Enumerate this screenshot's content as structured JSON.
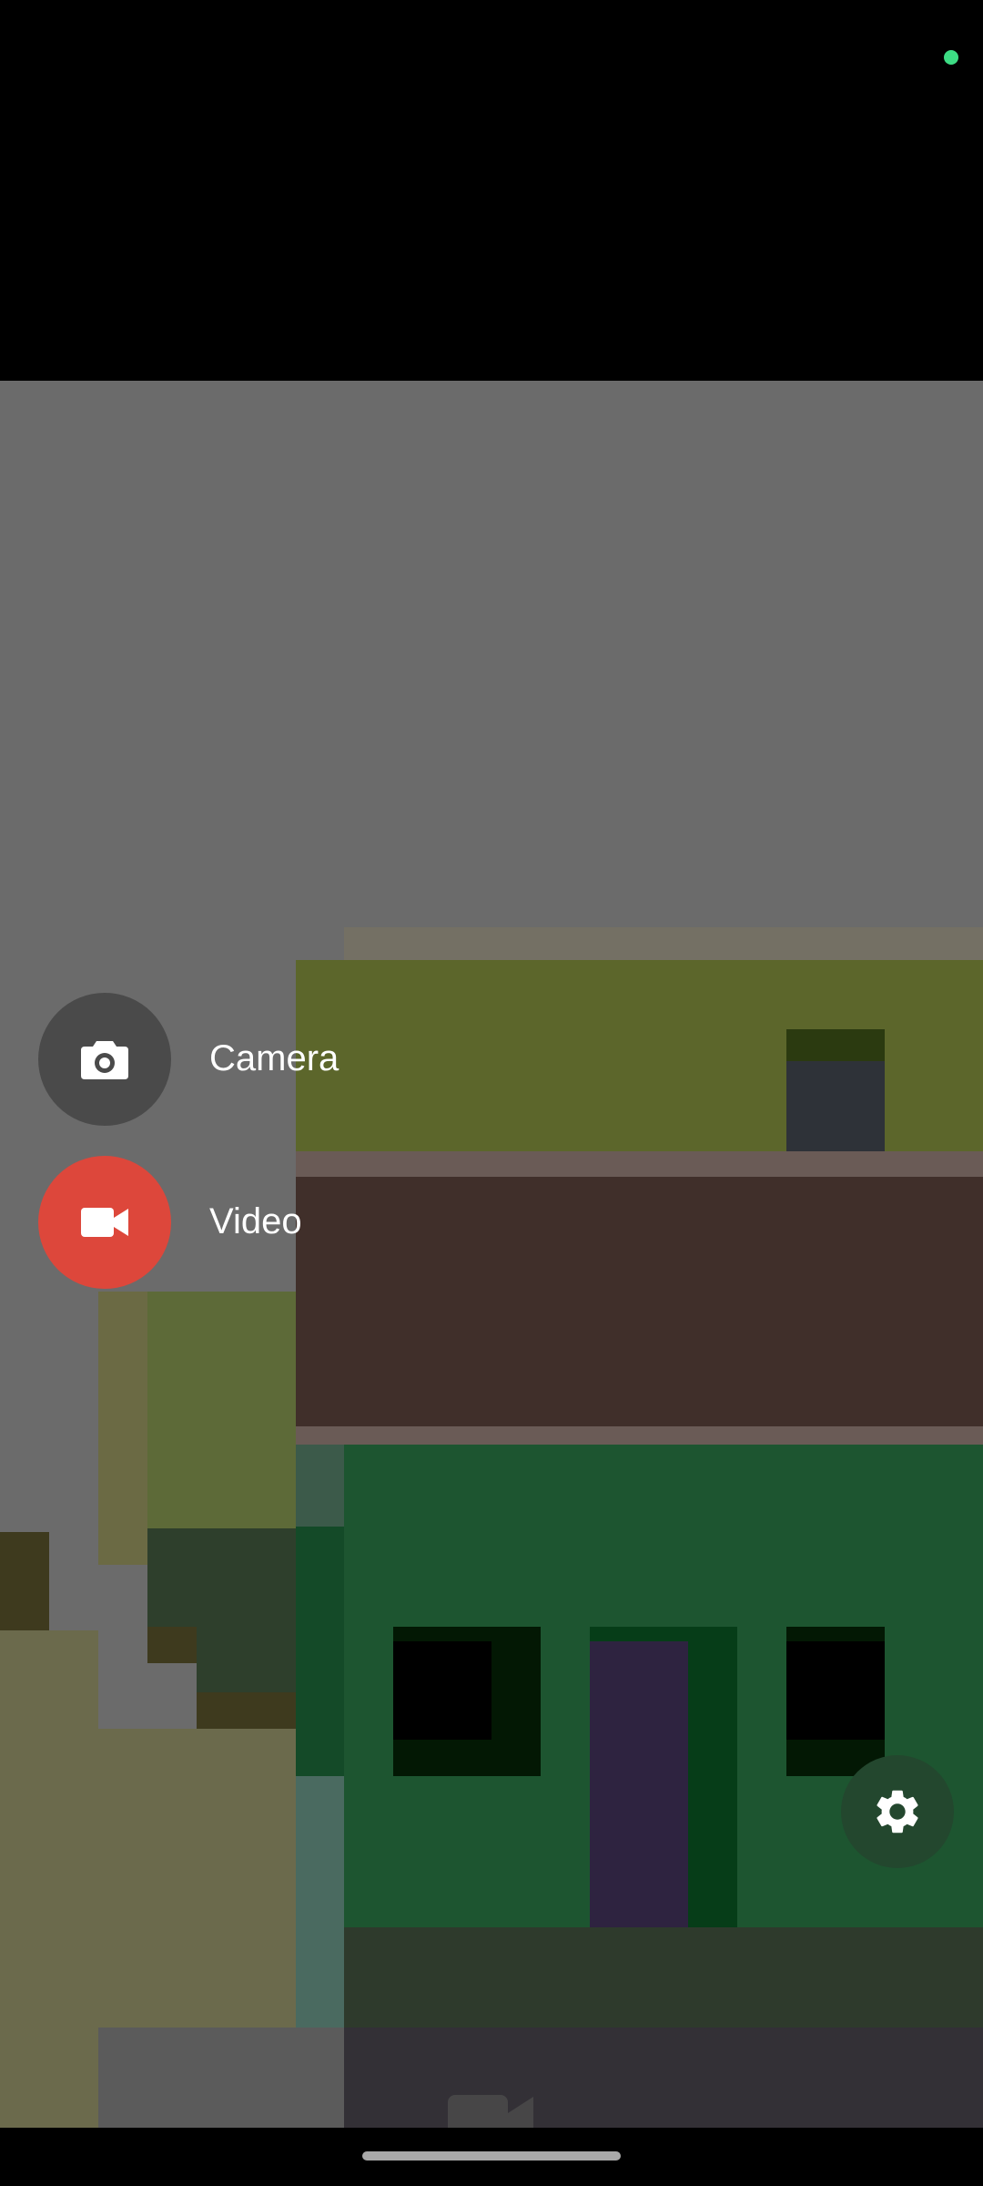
{
  "app": {
    "modes": [
      {
        "label": "Camera",
        "icon": "camera-icon",
        "color": "#4a4a4a"
      },
      {
        "label": "Video",
        "icon": "videocam-icon",
        "color": "#dd473b"
      }
    ],
    "settings": {
      "icon": "gear-icon",
      "color": "#23472e"
    },
    "capture": {
      "icon": "videocam-icon"
    }
  },
  "colors": {
    "privacy_dot": "#3ddc84",
    "video_accent": "#dd473b",
    "camera_fab": "#4a4a4a"
  }
}
